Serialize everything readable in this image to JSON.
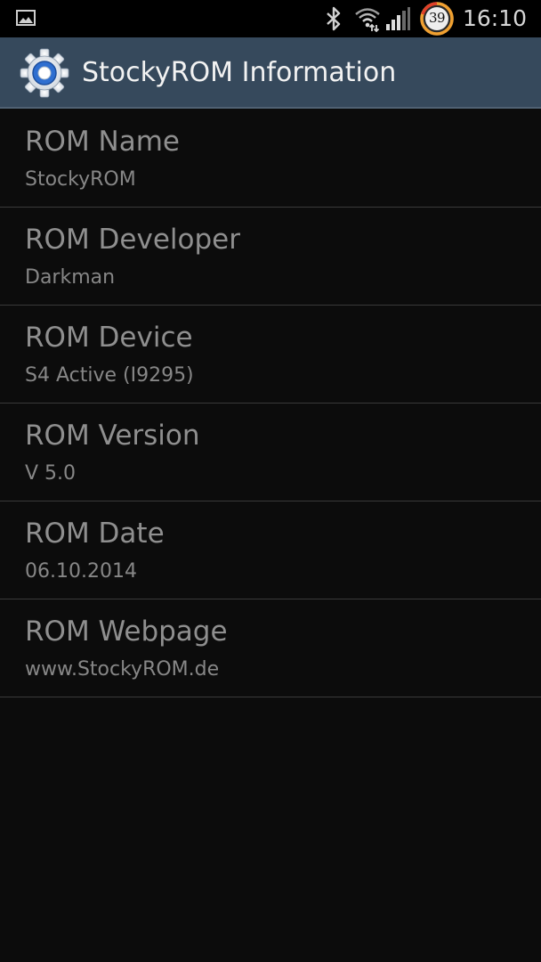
{
  "status_bar": {
    "notification_icon": "gallery-icon",
    "icons": [
      "bluetooth-icon",
      "wifi-icon",
      "signal-icon"
    ],
    "battery_level": "39",
    "time": "16:10"
  },
  "action_bar": {
    "app_icon": "settings-gear-icon",
    "title": "StockyROM Information"
  },
  "items": [
    {
      "label": "ROM Name",
      "value": "StockyROM"
    },
    {
      "label": "ROM Developer",
      "value": "Darkman"
    },
    {
      "label": "ROM Device",
      "value": "S4 Active (I9295)"
    },
    {
      "label": "ROM Version",
      "value": "V 5.0"
    },
    {
      "label": "ROM Date",
      "value": "06.10.2014"
    },
    {
      "label": "ROM Webpage",
      "value": "www.StockyROM.de"
    }
  ],
  "colors": {
    "action_bar": "#36495c",
    "background": "#0c0c0c",
    "status_bar": "#000000"
  }
}
